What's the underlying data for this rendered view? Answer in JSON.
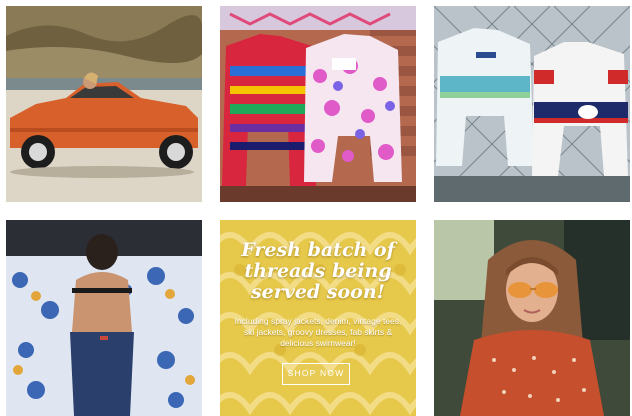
{
  "grid": {
    "posts": [
      {
        "subject": "orange-sports-car"
      },
      {
        "subject": "colorful-vintage-jackets"
      },
      {
        "subject": "white-track-jackets"
      },
      {
        "subject": "woman-on-floral-bed"
      },
      {
        "subject": "promo-graphic"
      },
      {
        "subject": "woman-with-sunglasses-in-car"
      }
    ]
  },
  "promo": {
    "headline": "Fresh batch of threads being served soon!",
    "subtext": "Including spray jackets, denim, vintage tees, ski jackets, groovy dresses, fab skirts & delicious swimwear!",
    "button_label": "SHOP NOW"
  },
  "colors": {
    "promo_yellow": "#e6c84a",
    "car_orange": "#d8602a",
    "accent_text": "#ffffff"
  }
}
